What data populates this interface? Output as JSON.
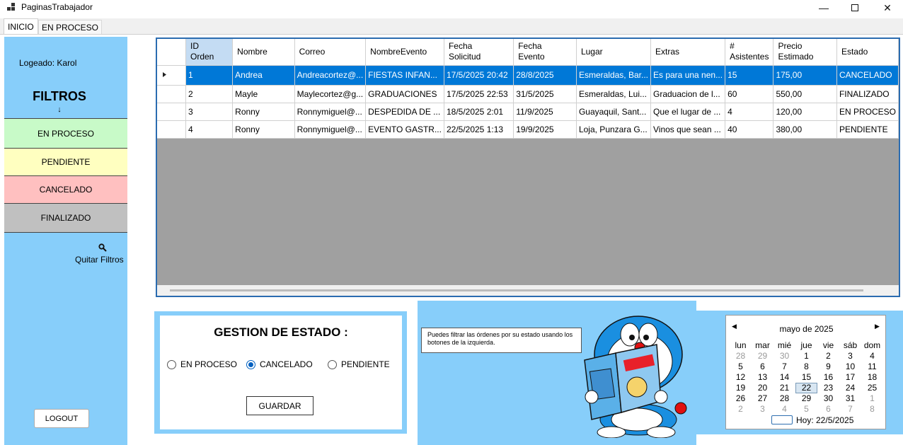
{
  "window": {
    "title": "PaginasTrabajador"
  },
  "tabs": [
    {
      "label": "INICIO"
    },
    {
      "label": "EN PROCESO"
    }
  ],
  "sidebar": {
    "logged_user": "Logeado: Karol",
    "filters_title": "FILTROS",
    "filters_arrow": "↓",
    "filter_buttons": [
      {
        "label": "EN PROCESO",
        "color": "#c8fac8"
      },
      {
        "label": "PENDIENTE",
        "color": "#ffffc0"
      },
      {
        "label": "CANCELADO",
        "color": "#ffc0c0"
      },
      {
        "label": "FINALIZADO",
        "color": "#c0c0c0"
      }
    ],
    "clear_filters_label": "Quitar Filtros",
    "clear_filters_icon": "magnifier-icon",
    "logout_label": "LOGOUT"
  },
  "grid": {
    "columns": [
      [
        "ID",
        "Orden"
      ],
      [
        "Nombre"
      ],
      [
        "Correo"
      ],
      [
        "NombreEvento"
      ],
      [
        "Fecha",
        "Solicitud"
      ],
      [
        "Fecha",
        "Evento"
      ],
      [
        "Lugar"
      ],
      [
        "Extras"
      ],
      [
        "#",
        "Asistentes"
      ],
      [
        "Precio",
        "Estimado"
      ],
      [
        "Estado"
      ]
    ],
    "rows": [
      [
        "1",
        "Andrea",
        "Andreacortez@...",
        "FIESTAS INFAN...",
        "17/5/2025 20:42",
        "28/8/2025",
        "Esmeraldas, Bar...",
        "Es para una nen...",
        "15",
        "175,00",
        "CANCELADO"
      ],
      [
        "2",
        "Mayle",
        "Maylecortez@g...",
        "GRADUACIONES",
        "17/5/2025 22:53",
        "31/5/2025",
        "Esmeraldas, Lui...",
        "Graduacion de l...",
        "60",
        "550,00",
        "FINALIZADO"
      ],
      [
        "3",
        "Ronny",
        "Ronnymiguel@...",
        "DESPEDIDA DE ...",
        "18/5/2025 2:01",
        "11/9/2025",
        "Guayaquil, Sant...",
        "Que el lugar de ...",
        "4",
        "120,00",
        "EN PROCESO"
      ],
      [
        "4",
        "Ronny",
        "Ronnymiguel@...",
        "EVENTO GASTR...",
        "22/5/2025 1:13",
        "19/9/2025",
        "Loja, Punzara G...",
        "Vinos que sean ...",
        "40",
        "380,00",
        "PENDIENTE"
      ]
    ],
    "selected_row": 0
  },
  "gestion": {
    "title": "GESTION DE ESTADO :",
    "options": [
      {
        "label": "EN PROCESO",
        "checked": false
      },
      {
        "label": "CANCELADO",
        "checked": true
      },
      {
        "label": "PENDIENTE",
        "checked": false
      }
    ],
    "save_label": "GUARDAR"
  },
  "tip": {
    "text": "Puedes filtrar las órdenes por su estado usando los botones de la izquierda."
  },
  "calendar": {
    "month_label": "mayo de 2025",
    "weekdays": [
      "lun",
      "mar",
      "mié",
      "jue",
      "vie",
      "sáb",
      "dom"
    ],
    "weeks": [
      [
        "28",
        "29",
        "30",
        "1",
        "2",
        "3",
        "4"
      ],
      [
        "5",
        "6",
        "7",
        "8",
        "9",
        "10",
        "11"
      ],
      [
        "12",
        "13",
        "14",
        "15",
        "16",
        "17",
        "18"
      ],
      [
        "19",
        "20",
        "21",
        "22",
        "23",
        "24",
        "25"
      ],
      [
        "26",
        "27",
        "28",
        "29",
        "30",
        "31",
        "1"
      ],
      [
        "2",
        "3",
        "4",
        "5",
        "6",
        "7",
        "8"
      ]
    ],
    "today_label": "Hoy: 22/5/2025"
  },
  "colors": {
    "panel": "#87cefa",
    "selection": "#0078d7",
    "grid_bg": "#a0a0a0"
  }
}
